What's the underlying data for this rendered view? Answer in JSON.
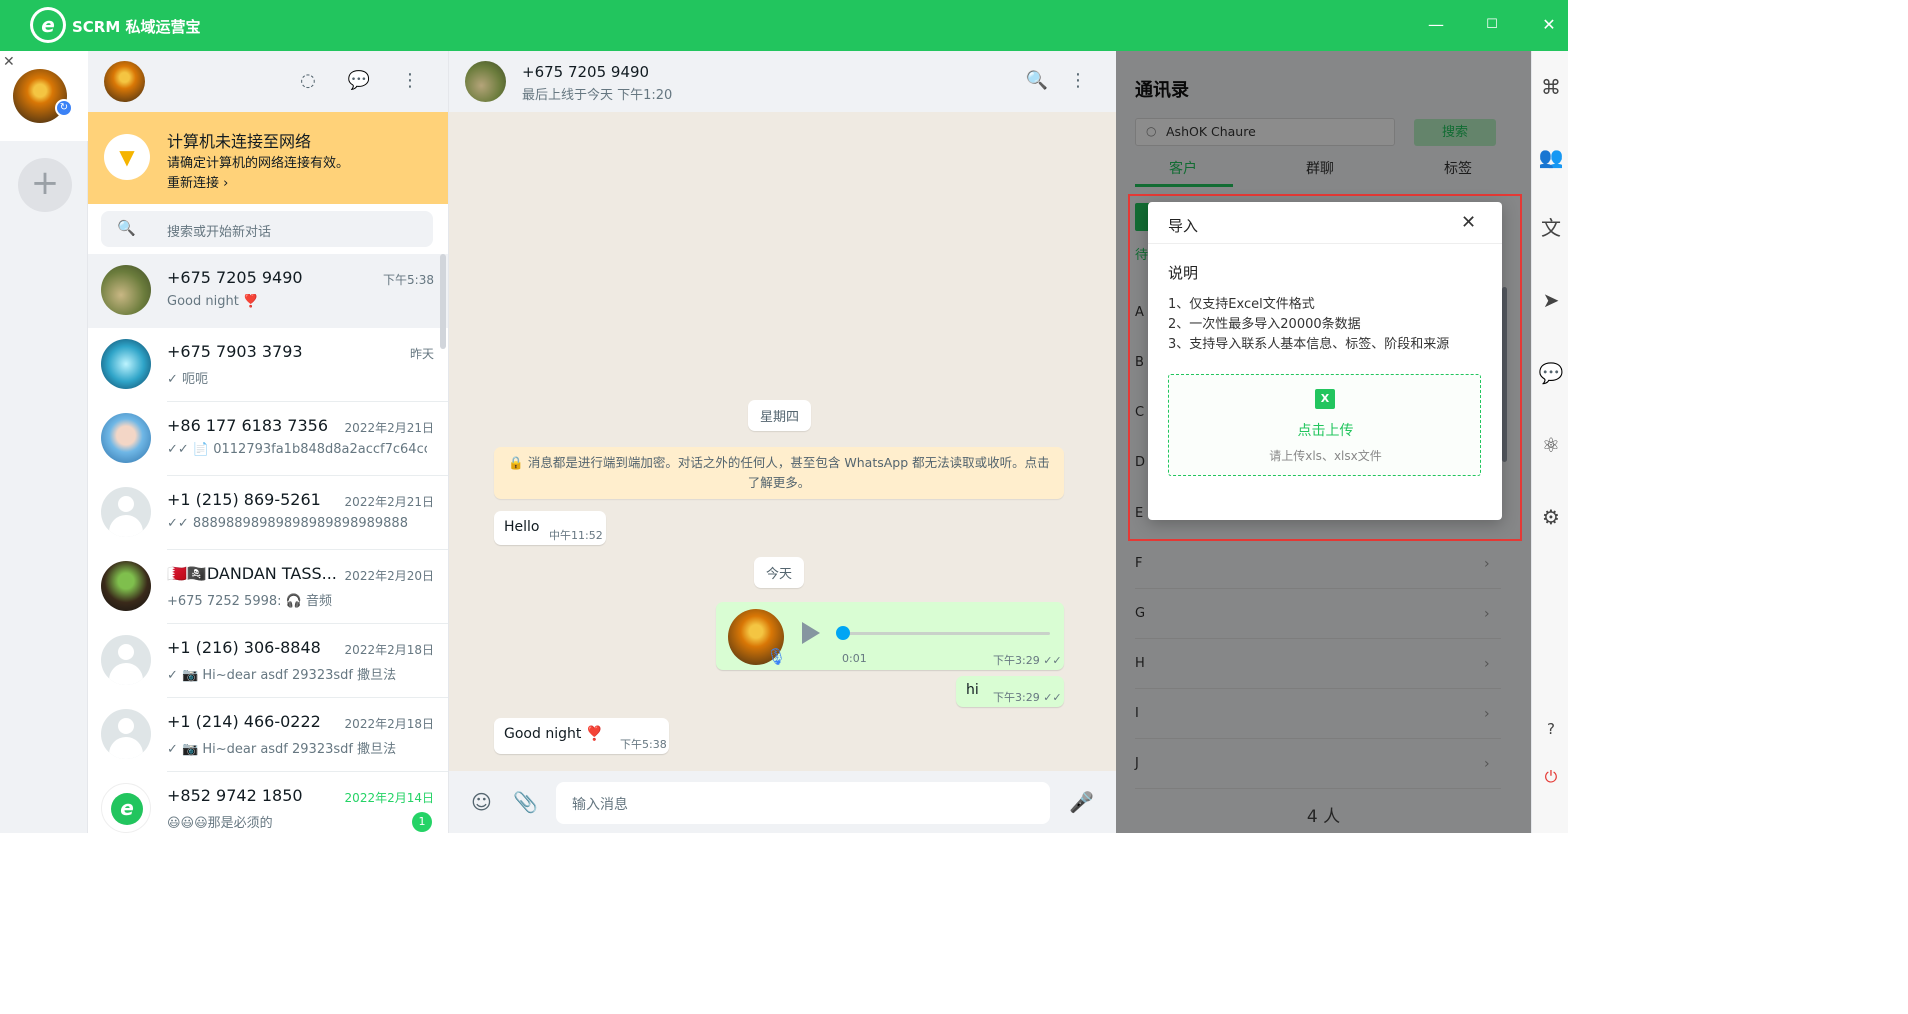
{
  "app": {
    "title": "SCRM 私域运营宝",
    "logo_letter": "e",
    "brand_color": "#22c55e"
  },
  "window_controls": {
    "minimize": "—",
    "maximize": "☐",
    "close": "✕"
  },
  "account_rail": {
    "close": "✕",
    "add": "+",
    "sync_badge": "↻"
  },
  "chat_list": {
    "offline_banner": {
      "title": "计算机未连接至网络",
      "subtitle": "请确定计算机的网络连接有效。",
      "link": "重新连接 ›"
    },
    "search_placeholder": "搜索或开始新对话",
    "items": [
      {
        "name": "+675 7205 9490",
        "time": "下午5:38",
        "preview": "Good night ❣️",
        "avatar": "photo-garden"
      },
      {
        "name": "+675 7903 3793",
        "time": "昨天",
        "preview": "✓ 呃呃",
        "avatar": "photo-blue"
      },
      {
        "name": "+86 177 6183 7356",
        "time": "2022年2月21日",
        "preview": "✓✓ 📄 0112793fa1b848d8a2accf7c64cc...",
        "avatar": "photo-girl"
      },
      {
        "name": "+1 (215) 869-5261",
        "time": "2022年2月21日",
        "preview": "✓✓ 88898898989898989898989888",
        "avatar": "default"
      },
      {
        "name": "🇧🇭🏴‍☠️DANDAN TASS...",
        "time": "2022年2月20日",
        "preview": "+675 7252 5998: 🎧 音频",
        "avatar": "photo-dark"
      },
      {
        "name": "+1 (216) 306-8848",
        "time": "2022年2月18日",
        "preview": "✓ 📷 Hi~dear asdf 29323sdf 撒旦法",
        "avatar": "default"
      },
      {
        "name": "+1 (214) 466-0222",
        "time": "2022年2月18日",
        "preview": "✓ 📷 Hi~dear asdf 29323sdf 撒旦法",
        "avatar": "default"
      },
      {
        "name": "+852 9742 1850",
        "time": "2022年2月14日",
        "preview": "😃😃😃那是必须的",
        "avatar": "logo",
        "unread": "1"
      }
    ]
  },
  "conversation": {
    "name": "+675 7205 9490",
    "status": "最后上线于今天 下午1:20",
    "day_thursday": "星期四",
    "encryption_notice": "🔒 消息都是进行端到端加密。对话之外的任何人，甚至包含 WhatsApp 都无法读取或收听。点击了解更多。",
    "msg_hello": {
      "text": "Hello",
      "time": "中午11:52"
    },
    "day_today": "今天",
    "voice": {
      "duration": "0:01",
      "time": "下午3:29 ✓✓",
      "progress": 0
    },
    "msg_hi": {
      "text": "hi",
      "time": "下午3:29 ✓✓"
    },
    "msg_goodnight": {
      "text": "Good night ❣️",
      "time": "下午5:38"
    },
    "composer_placeholder": "输入消息"
  },
  "contacts": {
    "title": "通讯录",
    "search_value": "AshOK Chaure",
    "search_button": "搜索",
    "tabs": [
      "客户",
      "群聊",
      "标签"
    ],
    "partial_tab": "待",
    "letters": [
      "A",
      "B",
      "C",
      "D",
      "E",
      "F",
      "G",
      "H",
      "I",
      "J"
    ],
    "count": "4 人"
  },
  "import_modal": {
    "title": "导入",
    "section": "说明",
    "lines": [
      "1、仅支持Excel文件格式",
      "2、一次性最多导入20000条数据",
      "3、支持导入联系人基本信息、标签、阶段和来源"
    ],
    "upload_label": "点击上传",
    "upload_hint": "请上传xls、xlsx文件",
    "excel_icon_glyph": "X"
  }
}
